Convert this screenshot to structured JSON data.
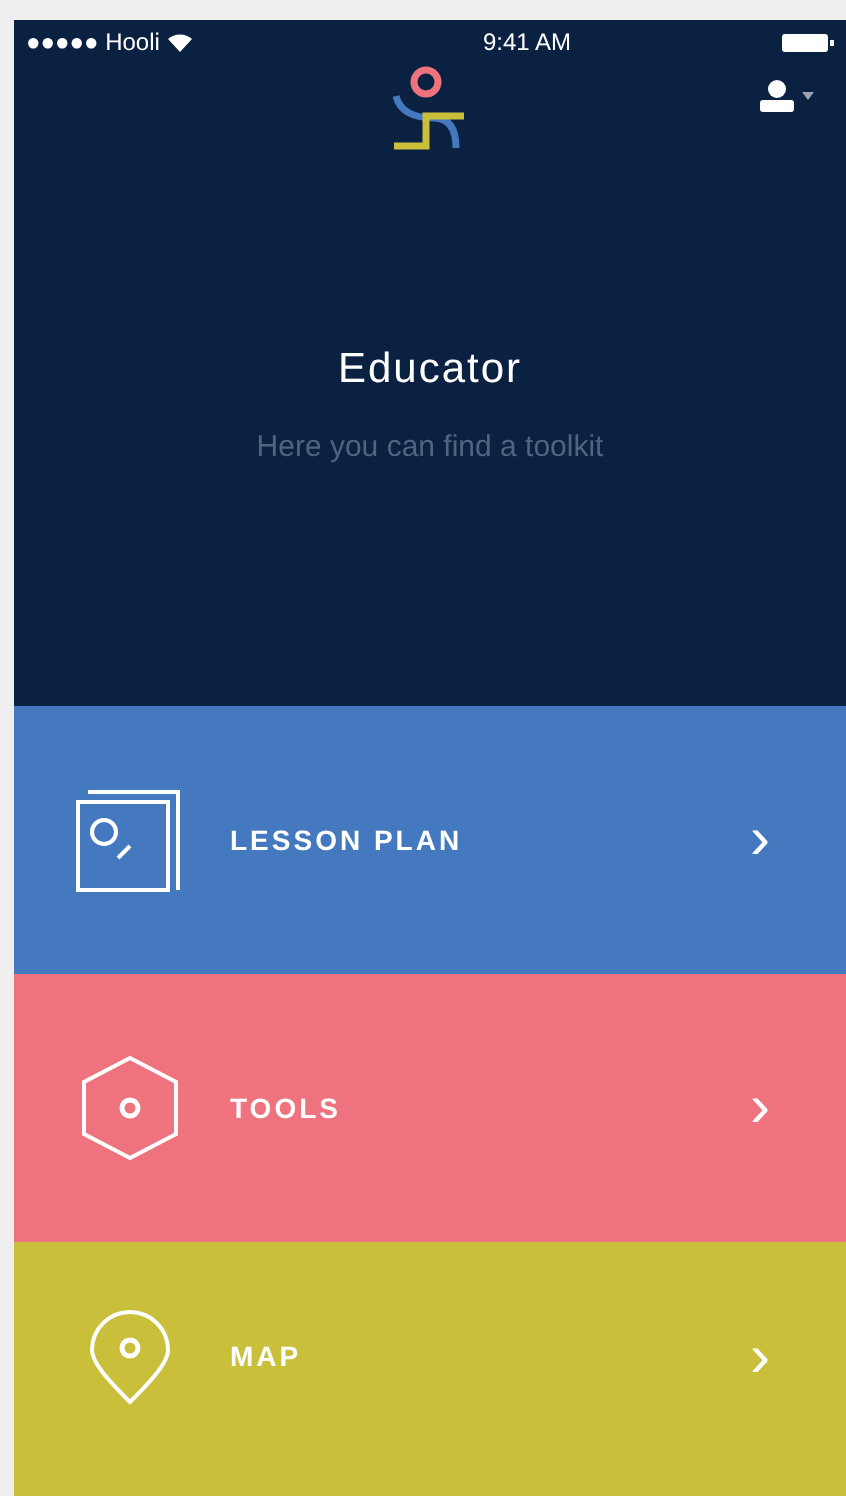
{
  "status_bar": {
    "carrier": "●●●●● Hooli",
    "time": "9:41 AM"
  },
  "header": {
    "title": "Educator",
    "subtitle": "Here you can find a toolkit"
  },
  "menu": [
    {
      "kind": "lesson",
      "label": "LESSON PLAN",
      "color": "#4479c0",
      "chevron": "›"
    },
    {
      "kind": "tools",
      "label": "TOOLS",
      "color": "#ef737e",
      "chevron": "›"
    },
    {
      "kind": "map",
      "label": "MAP",
      "color": "#c9bf3a",
      "chevron": "›"
    }
  ]
}
